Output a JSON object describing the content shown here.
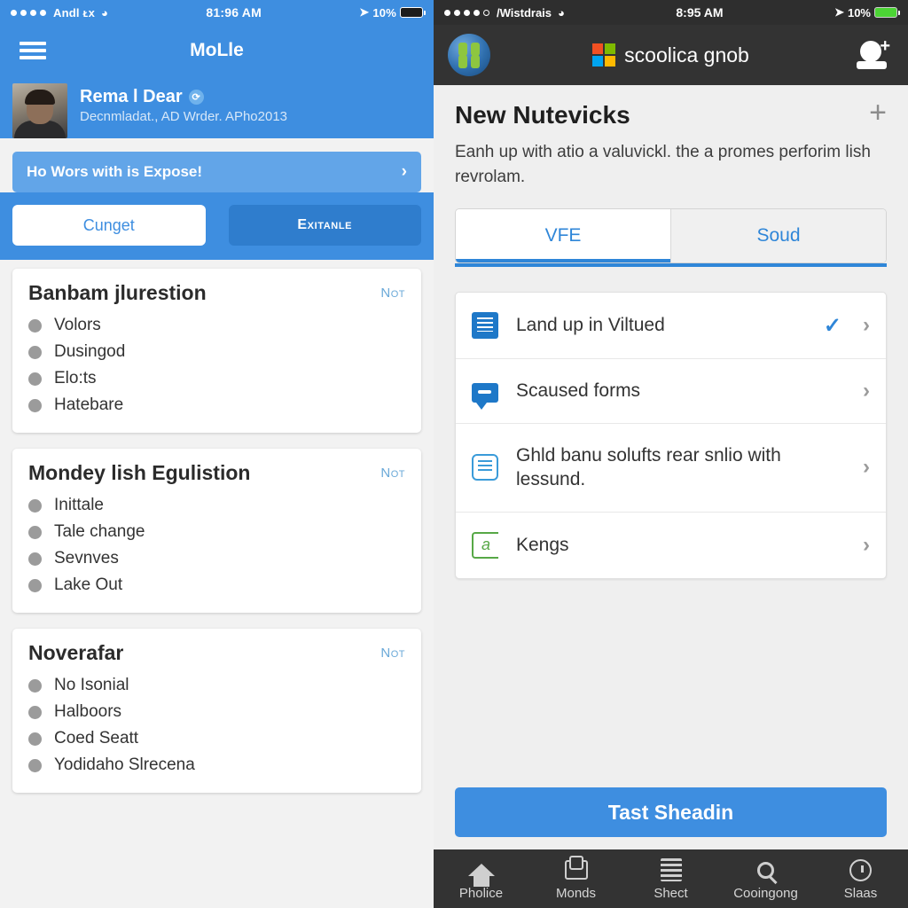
{
  "left": {
    "status": {
      "carrier": "Andl  ᴌx",
      "time": "81:96 AM",
      "battery": "10%"
    },
    "nav": {
      "title": "MoLle",
      "menu_icon": "hamburger-icon"
    },
    "profile": {
      "name": "Rema l Dear",
      "subtitle": "Decnmladat., AD Wrder. APho2013",
      "verified_icon": "verified-badge-icon"
    },
    "banner": {
      "text": "Ho Wors with is Expose!",
      "chevron": "›"
    },
    "buttons": {
      "primary": "Cunget",
      "secondary": "Exitanle"
    },
    "cards": [
      {
        "title": "Banbam jlurestion",
        "action": "Not",
        "items": [
          "Volors",
          "Dusingod",
          "Elo:ts",
          "Hatebare"
        ]
      },
      {
        "title": "Mondey lish Egulistion",
        "action": "Not",
        "items": [
          "Inittale",
          "Tale change",
          "Sevnves",
          "Lake Out"
        ]
      },
      {
        "title": "Noverafar",
        "action": "Not",
        "items": [
          "No Isonial",
          "Halboors",
          "Coed Seatt",
          "Yodidaho Slrecena"
        ]
      }
    ]
  },
  "right": {
    "status": {
      "carrier": "/Wistdrais",
      "time": "8:95 AM",
      "battery": "10%"
    },
    "nav": {
      "app_icon": "globe-icon",
      "brand": "scoolica gnob",
      "logo": "microsoft-logo",
      "account_icon": "person-add-icon"
    },
    "header": {
      "title": "New Nutevicks",
      "add_label": "+"
    },
    "description": "Eanh up with atio a valuvickl. the a promes perforim lish revrolam.",
    "tabs": [
      {
        "label": "VFE",
        "active": true
      },
      {
        "label": "Soud",
        "active": false
      }
    ],
    "list": [
      {
        "icon": "document-icon",
        "label": "Land up in Viltued",
        "checked": true,
        "chevron": "›"
      },
      {
        "icon": "chat-icon",
        "label": "Scaused forms",
        "checked": false,
        "chevron": "›"
      },
      {
        "icon": "form-icon",
        "label": "Ghld banu solufts rear snlio with lessund.",
        "checked": false,
        "chevron": "›"
      },
      {
        "icon": "text-a-icon",
        "label": "Kengs",
        "checked": false,
        "chevron": "›"
      }
    ],
    "cta": "Tast Sheadin",
    "tabbar": [
      {
        "label": "Pholice",
        "icon": "home-icon"
      },
      {
        "label": "Monds",
        "icon": "board-icon"
      },
      {
        "label": "Shect",
        "icon": "list-icon"
      },
      {
        "label": "Cooingong",
        "icon": "search-icon"
      },
      {
        "label": "Slaas",
        "icon": "clock-icon"
      }
    ]
  },
  "colors": {
    "accent_blue": "#3E8EE0",
    "banner_blue": "#62A5E8",
    "dark_chrome": "#333333",
    "tab_blue": "#2F86D8",
    "ms_red": "#F25022",
    "ms_green": "#7FBA00",
    "ms_blue": "#00A4EF",
    "ms_yellow": "#FFB900"
  }
}
